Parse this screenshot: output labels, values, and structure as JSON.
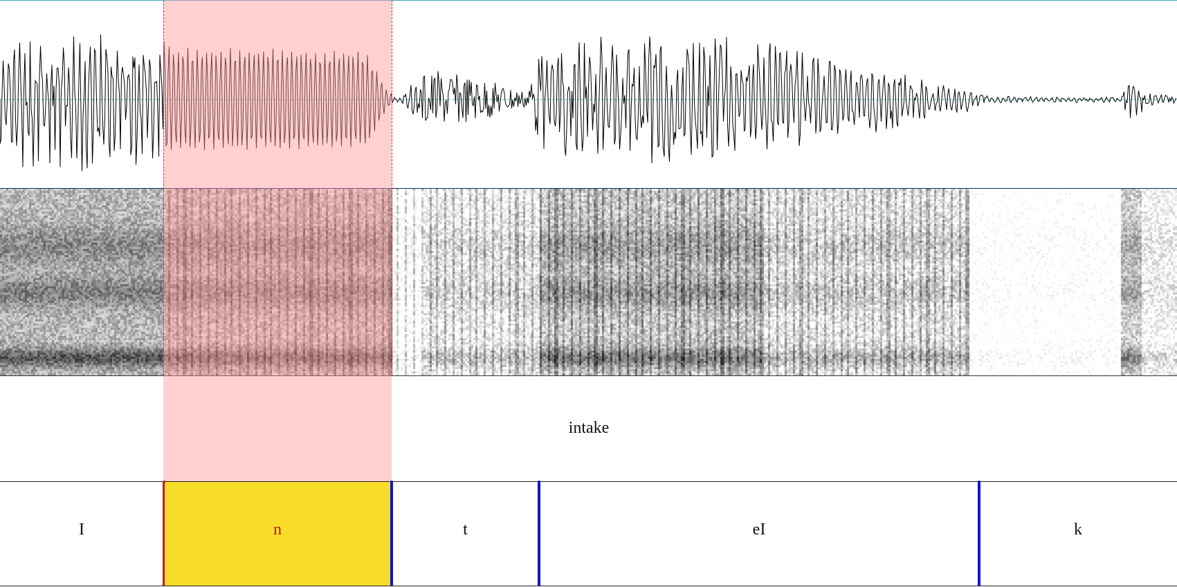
{
  "word_tier": {
    "words": [
      "intake"
    ]
  },
  "phone_tier": {
    "segments": [
      {
        "label": "I",
        "selected": false
      },
      {
        "label": "n",
        "selected": true
      },
      {
        "label": "t",
        "selected": false
      },
      {
        "label": "eI",
        "selected": false
      },
      {
        "label": "k",
        "selected": false
      }
    ]
  },
  "colors": {
    "selection_tint": "#ffd1d1",
    "selected_segment_fill": "#f8dd2a",
    "selected_segment_text": "#c0161a",
    "boundary": "#0a16c8",
    "selected_boundary": "#d01818",
    "waveform_trace": "#000000",
    "waveform_baseline": "#3aa9c9"
  }
}
